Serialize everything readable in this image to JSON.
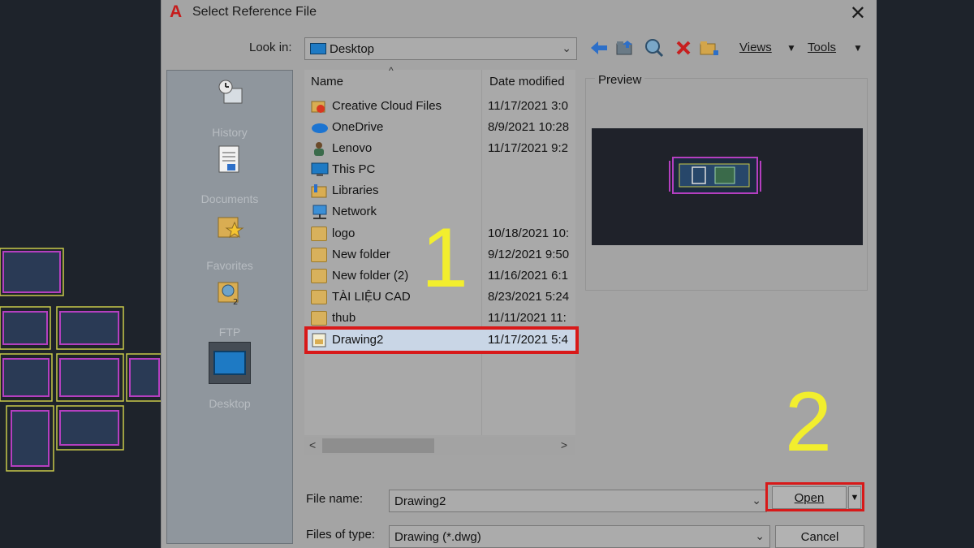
{
  "dialog": {
    "title": "Select Reference File",
    "app_icon_glyph": "A",
    "close_glyph": "✕"
  },
  "toolbar": {
    "look_in_label": "Look in:",
    "look_in_value": "Desktop",
    "views_label": "Views",
    "tools_label": "Tools",
    "icons": [
      "back-arrow-icon",
      "up-folder-icon",
      "search-web-icon",
      "delete-icon",
      "new-folder-icon"
    ]
  },
  "places": [
    {
      "label": "History",
      "icon": "history-icon"
    },
    {
      "label": "Documents",
      "icon": "documents-icon"
    },
    {
      "label": "Favorites",
      "icon": "favorites-icon"
    },
    {
      "label": "FTP",
      "icon": "ftp-icon"
    },
    {
      "label": "Desktop",
      "icon": "desktop-icon",
      "selected": true
    }
  ],
  "file_list": {
    "columns": [
      "Name",
      "Date modified"
    ],
    "rows": [
      {
        "name": "Creative Cloud Files",
        "date": "11/17/2021 3:0",
        "icon": "creative-cloud-folder-icon"
      },
      {
        "name": "OneDrive",
        "date": "8/9/2021 10:28",
        "icon": "onedrive-icon"
      },
      {
        "name": "Lenovo",
        "date": "11/17/2021 9:2",
        "icon": "user-icon"
      },
      {
        "name": "This PC",
        "date": "",
        "icon": "computer-icon"
      },
      {
        "name": "Libraries",
        "date": "",
        "icon": "libraries-icon"
      },
      {
        "name": "Network",
        "date": "",
        "icon": "network-icon"
      },
      {
        "name": "logo",
        "date": "10/18/2021 10:",
        "icon": "folder-icon"
      },
      {
        "name": "New folder",
        "date": "9/12/2021 9:50",
        "icon": "folder-icon"
      },
      {
        "name": "New folder (2)",
        "date": "11/16/2021 6:1",
        "icon": "folder-icon"
      },
      {
        "name": "TÀI LIỆU CAD",
        "date": "8/23/2021 5:24",
        "icon": "folder-icon"
      },
      {
        "name": "thub",
        "date": "11/11/2021 11:",
        "icon": "folder-icon"
      },
      {
        "name": "Drawing2",
        "date": "11/17/2021 5:4",
        "icon": "dwg-file-icon",
        "selected": true
      }
    ]
  },
  "annotations": {
    "step1": "1",
    "step2": "2"
  },
  "preview": {
    "label": "Preview"
  },
  "bottom": {
    "file_name_label": "File name:",
    "file_name_value": "Drawing2",
    "file_type_label": "Files of type:",
    "file_type_value": "Drawing (*.dwg)",
    "open_label": "Open",
    "cancel_label": "Cancel"
  },
  "colors": {
    "dialog_bg": "#a4a4a4",
    "highlight_red": "#d81919",
    "annotation_yellow": "#f2ee2e",
    "cad_bg": "#1e232b"
  }
}
